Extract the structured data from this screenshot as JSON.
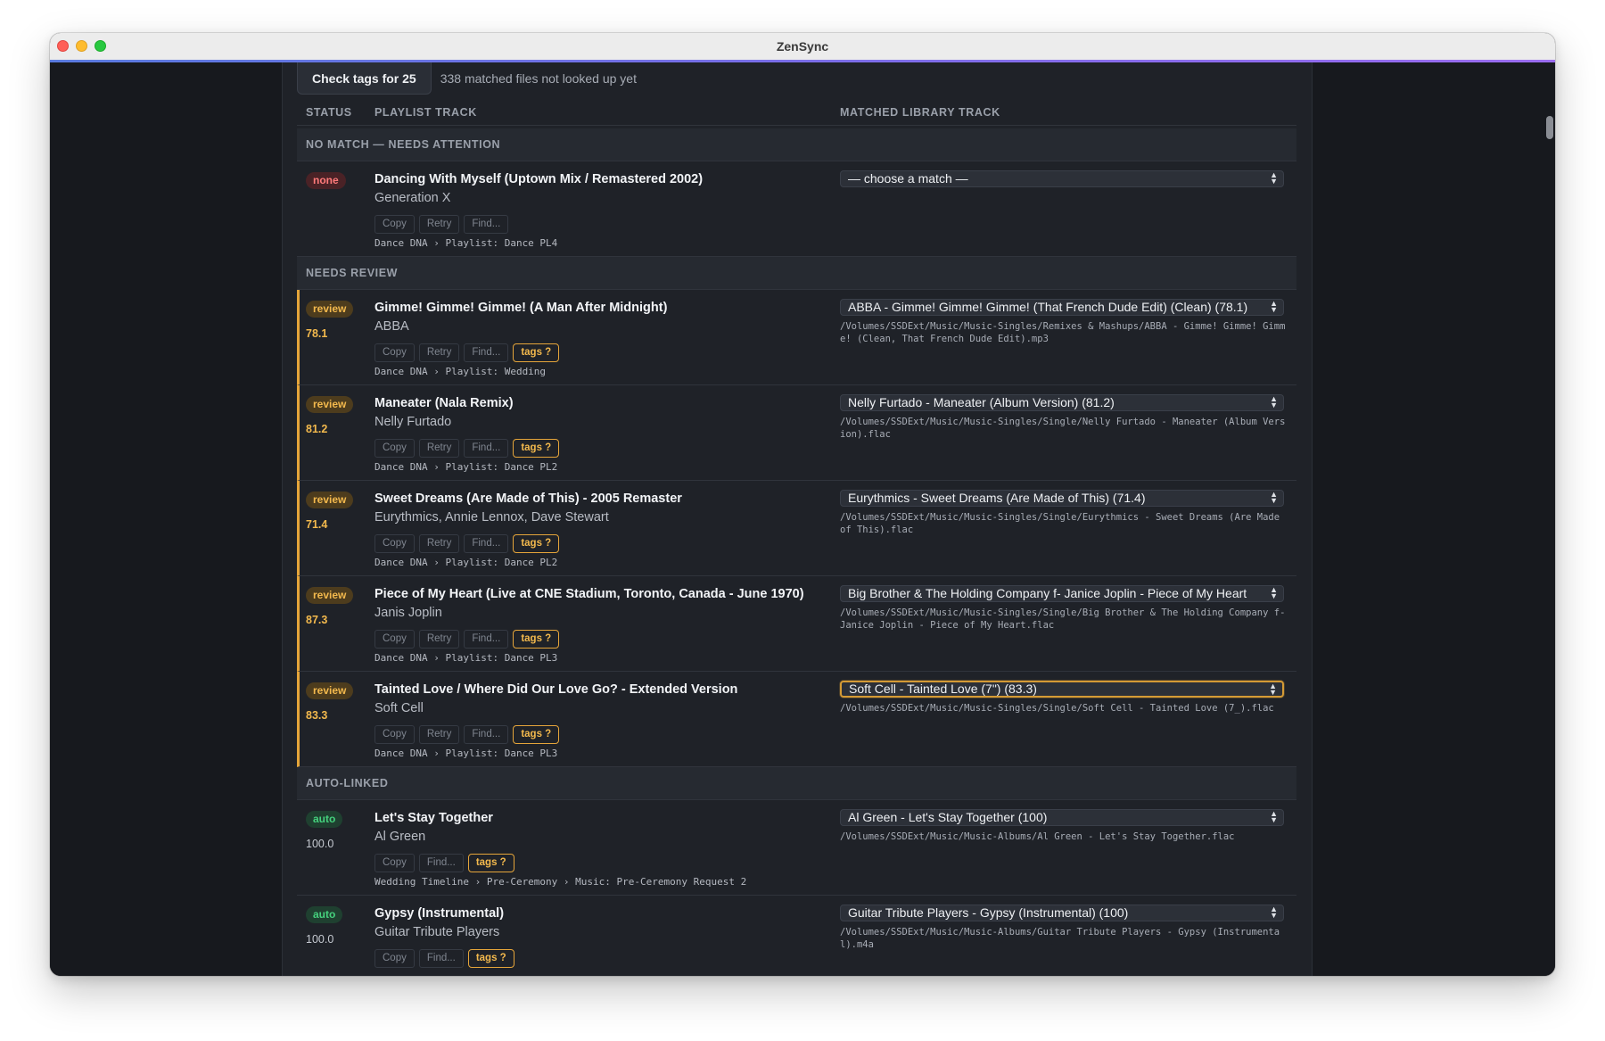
{
  "window": {
    "title": "ZenSync"
  },
  "toolbar": {
    "check_label": "Check tags for 25",
    "unmatched_text": "338 matched files not looked up yet"
  },
  "columns": {
    "status": "STATUS",
    "playlist": "PLAYLIST TRACK",
    "matched": "MATCHED LIBRARY TRACK"
  },
  "actions": {
    "copy": "Copy",
    "retry": "Retry",
    "find": "Find...",
    "tags": "tags ?"
  },
  "sections": {
    "nomatch": "NO MATCH — NEEDS ATTENTION",
    "review": "NEEDS REVIEW",
    "auto": "AUTO-LINKED"
  },
  "nomatch_rows": [
    {
      "status": "none",
      "title": "Dancing With Myself (Uptown Mix / Remastered 2002)",
      "artist": "Generation X",
      "source": "Dance DNA › Playlist: Dance PL4",
      "match": "— choose a match —"
    }
  ],
  "review_rows": [
    {
      "status": "review",
      "score": "78.1",
      "title": "Gimme! Gimme! Gimme! (A Man After Midnight)",
      "artist": "ABBA",
      "source": "Dance DNA › Playlist: Wedding",
      "match": "ABBA - Gimme! Gimme! Gimme! (That French Dude Edit) (Clean) (78.1)",
      "path": "/Volumes/SSDExt/Music/Music-Singles/Remixes & Mashups/ABBA - Gimme! Gimme! Gimme! (Clean, That French Dude Edit).mp3"
    },
    {
      "status": "review",
      "score": "81.2",
      "title": "Maneater (Nala Remix)",
      "artist": "Nelly Furtado",
      "source": "Dance DNA › Playlist: Dance PL2",
      "match": "Nelly Furtado - Maneater (Album Version) (81.2)",
      "path": "/Volumes/SSDExt/Music/Music-Singles/Single/Nelly Furtado - Maneater (Album Version).flac"
    },
    {
      "status": "review",
      "score": "71.4",
      "title": "Sweet Dreams (Are Made of This) - 2005 Remaster",
      "artist": "Eurythmics, Annie Lennox, Dave Stewart",
      "source": "Dance DNA › Playlist: Dance PL2",
      "match": "Eurythmics - Sweet Dreams (Are Made of This) (71.4)",
      "path": "/Volumes/SSDExt/Music/Music-Singles/Single/Eurythmics - Sweet Dreams (Are Made of This).flac"
    },
    {
      "status": "review",
      "score": "87.3",
      "title": "Piece of My Heart (Live at CNE Stadium, Toronto, Canada - June 1970)",
      "artist": "Janis Joplin",
      "source": "Dance DNA › Playlist: Dance PL3",
      "match": "Big Brother & The Holding Company f- Janice Joplin - Piece of My Heart",
      "path": "/Volumes/SSDExt/Music/Music-Singles/Single/Big Brother & The Holding Company f- Janice Joplin - Piece of My Heart.flac"
    },
    {
      "status": "review",
      "score": "83.3",
      "title": "Tainted Love / Where Did Our Love Go? - Extended Version",
      "artist": "Soft Cell",
      "source": "Dance DNA › Playlist: Dance PL3",
      "match": "Soft Cell - Tainted Love (7\") (83.3)",
      "path": "/Volumes/SSDExt/Music/Music-Singles/Single/Soft Cell - Tainted Love (7_).flac"
    }
  ],
  "auto_rows": [
    {
      "status": "auto",
      "score": "100.0",
      "title": "Let's Stay Together",
      "artist": "Al Green",
      "source": "Wedding Timeline › Pre-Ceremony › Music: Pre-Ceremony Request 2",
      "match": "Al Green - Let's Stay Together (100)",
      "path": "/Volumes/SSDExt/Music/Music-Albums/Al Green - Let's Stay Together.flac"
    },
    {
      "status": "auto",
      "score": "100.0",
      "title": "Gypsy (Instrumental)",
      "artist": "Guitar Tribute Players",
      "match": "Guitar Tribute Players - Gypsy (Instrumental) (100)",
      "path": "/Volumes/SSDExt/Music/Music-Albums/Guitar Tribute Players - Gypsy (Instrumental).m4a"
    }
  ],
  "colors": {
    "accent": "#7b6ee8",
    "review": "#f3b94d",
    "auto": "#45d17d",
    "none": "#ff7a7a"
  }
}
